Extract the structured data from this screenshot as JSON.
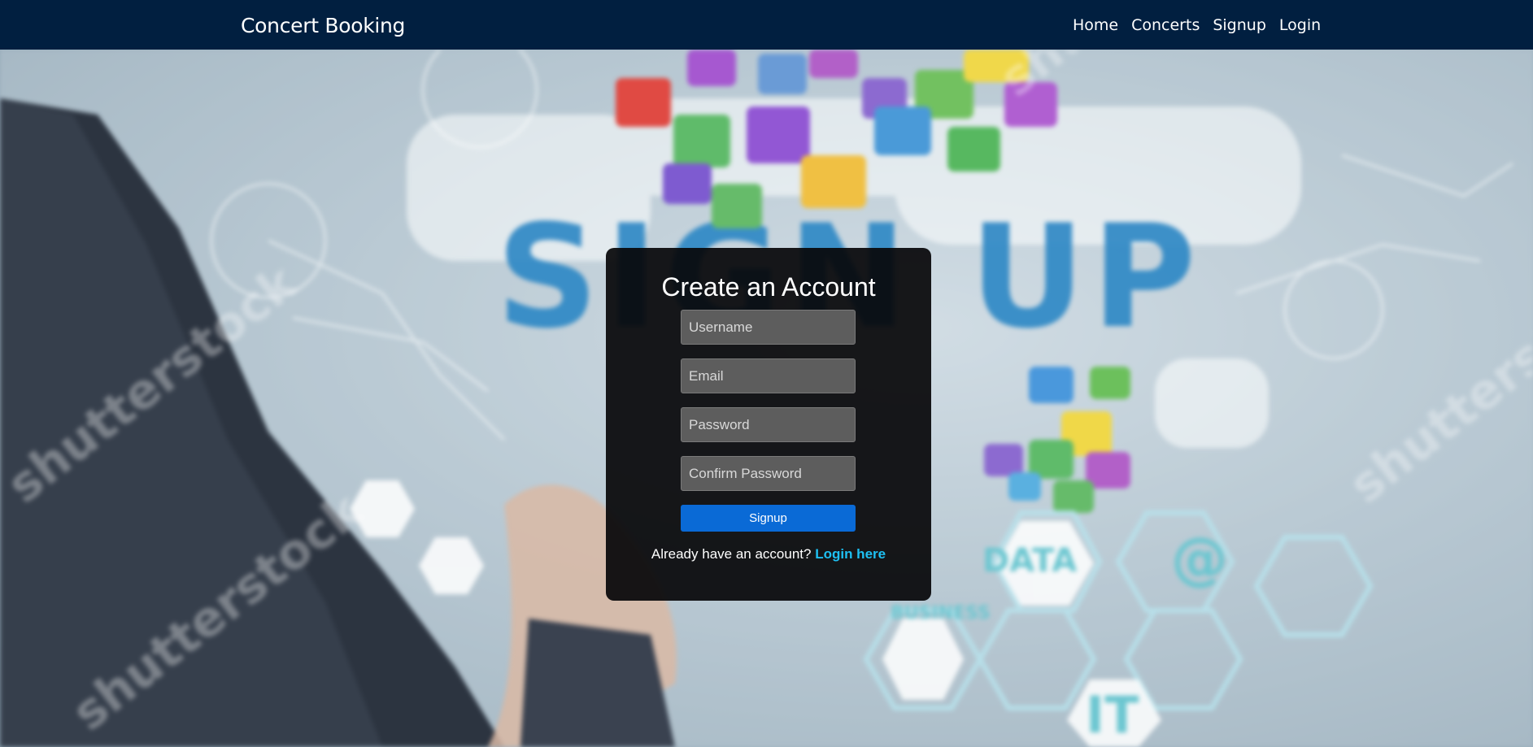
{
  "navbar": {
    "brand": "Concert Booking",
    "links": [
      "Home",
      "Concerts",
      "Signup",
      "Login"
    ]
  },
  "background": {
    "headline": "SIGN UP",
    "watermark": "shutterstock",
    "hex_labels": [
      "DATA",
      "BUSINESS",
      "IT",
      "@"
    ]
  },
  "signup_form": {
    "title": "Create an Account",
    "username_placeholder": "Username",
    "email_placeholder": "Email",
    "password_placeholder": "Password",
    "confirm_placeholder": "Confirm Password",
    "submit_label": "Signup",
    "login_prompt": "Already have an account?",
    "login_link": "Login here"
  },
  "colors": {
    "navbar": "#011f40",
    "button": "#0a6ad6",
    "link": "#1ec0f2"
  }
}
